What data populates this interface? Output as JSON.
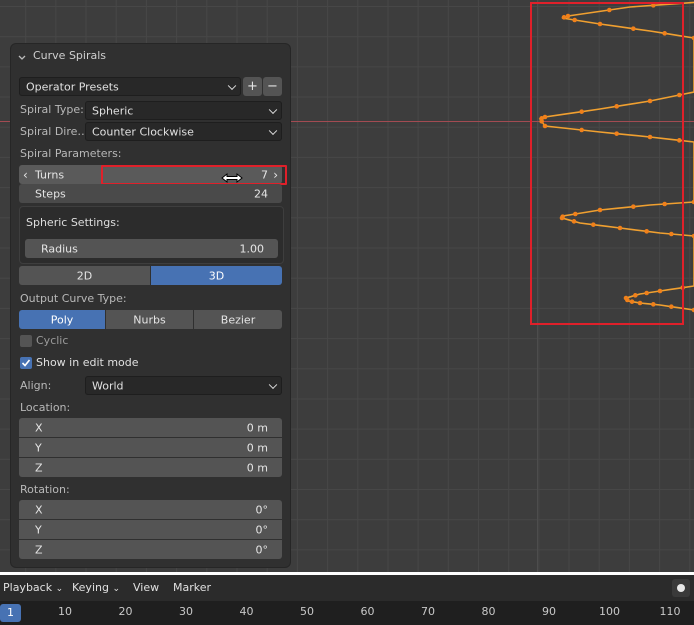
{
  "panel": {
    "title": "Curve Spirals",
    "presets": {
      "label": "Operator Presets",
      "add": "+",
      "remove": "−"
    },
    "spiral_type": {
      "label": "Spiral Type:",
      "value": "Spheric"
    },
    "spiral_direction": {
      "label": "Spiral Dire…",
      "value": "Counter Clockwise"
    },
    "spiral_params_label": "Spiral Parameters:",
    "turns": {
      "label": "Turns",
      "value": "7"
    },
    "steps": {
      "label": "Steps",
      "value": "24"
    },
    "spheric": {
      "label": "Spheric Settings:",
      "radius_label": "Radius",
      "radius_value": "1.00"
    },
    "dimension": {
      "options": [
        "2D",
        "3D"
      ],
      "active": "3D"
    },
    "output_type": {
      "label": "Output Curve Type:",
      "options": [
        "Poly",
        "Nurbs",
        "Bezier"
      ],
      "active": "Poly"
    },
    "cyclic": {
      "label": "Cyclic",
      "checked": false
    },
    "edit_mode": {
      "label": "Show in edit mode",
      "checked": true
    },
    "align": {
      "label": "Align:",
      "value": "World"
    },
    "location": {
      "label": "Location:",
      "x_label": "X",
      "x": "0 m",
      "y_label": "Y",
      "y": "0 m",
      "z_label": "Z",
      "z": "0 m"
    },
    "rotation": {
      "label": "Rotation:",
      "x_label": "X",
      "x": "0°",
      "y_label": "Y",
      "y": "0°",
      "z_label": "Z",
      "z": "0°"
    }
  },
  "timeline": {
    "menus": [
      "Playback",
      "Keying",
      "View",
      "Marker"
    ],
    "current_frame": "1",
    "ticks": [
      "10",
      "20",
      "30",
      "40",
      "50",
      "60",
      "70",
      "80",
      "90",
      "100",
      "110"
    ]
  },
  "colors": {
    "accent": "#4772b3",
    "curve": "#f0a030",
    "highlight": "#e0202a"
  },
  "icons": {
    "collapse": "chevron-down-icon",
    "checkbox": "checkmark-icon",
    "cursor": "resize-horizontal-icon",
    "record": "record-icon"
  }
}
